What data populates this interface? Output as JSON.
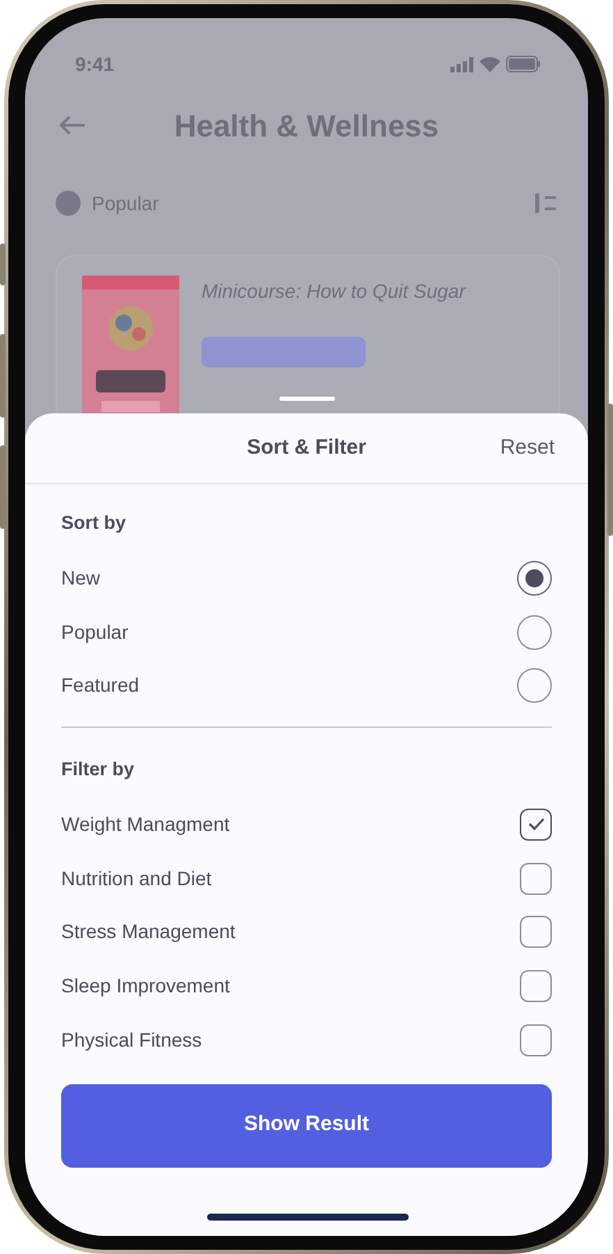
{
  "status_bar": {
    "time": "9:41"
  },
  "header": {
    "title": "Health & Wellness"
  },
  "toolbar": {
    "label": "Popular"
  },
  "course": {
    "title": "Minicourse: How to Quit Sugar"
  },
  "sheet": {
    "title": "Sort & Filter",
    "reset": "Reset",
    "sort": {
      "heading": "Sort by",
      "options": [
        {
          "label": "New",
          "selected": true
        },
        {
          "label": "Popular",
          "selected": false
        },
        {
          "label": "Featured",
          "selected": false
        }
      ]
    },
    "filter": {
      "heading": "Filter by",
      "options": [
        {
          "label": "Weight Managment",
          "checked": true
        },
        {
          "label": "Nutrition and Diet",
          "checked": false
        },
        {
          "label": "Stress Management",
          "checked": false
        },
        {
          "label": "Sleep Improvement",
          "checked": false
        },
        {
          "label": "Physical Fitness",
          "checked": false
        }
      ]
    },
    "button": "Show Result"
  }
}
